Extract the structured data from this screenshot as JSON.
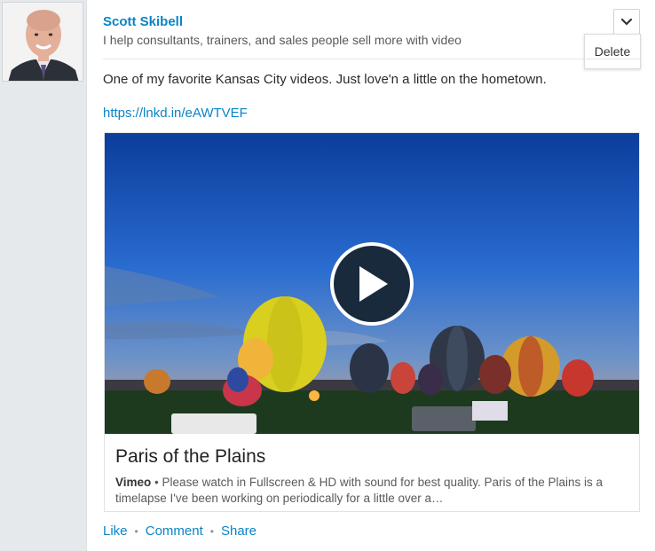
{
  "author": {
    "name": "Scott Skibell",
    "headline": "I help consultants, trainers, and sales people sell more with video"
  },
  "menu": {
    "toggle_icon": "chevron-down-icon",
    "delete_label": "Delete"
  },
  "post": {
    "text": "One of my favorite Kansas City videos. Just love'n a little on the hometown.",
    "link": "https://lnkd.in/eAWTVEF"
  },
  "video_card": {
    "title": "Paris of the Plains",
    "source": "Vimeo",
    "separator": "•",
    "description": "Please watch in Fullscreen & HD with sound for best quality. Paris of the Plains is a timelapse I've been working on periodically for a little over a…",
    "play_icon": "play-icon"
  },
  "actions": {
    "like": "Like",
    "comment": "Comment",
    "share": "Share",
    "dot": "•"
  },
  "colors": {
    "link": "#0a84c6",
    "play_button": "#1a2a3d"
  }
}
